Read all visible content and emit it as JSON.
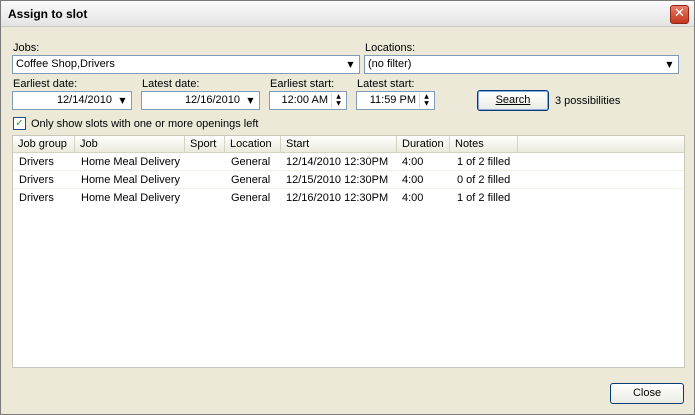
{
  "window": {
    "title": "Assign to slot"
  },
  "filters": {
    "jobs_label": "Jobs:",
    "jobs_value": "Coffee Shop,Drivers",
    "locations_label": "Locations:",
    "locations_value": "(no filter)",
    "earliest_date_label": "Earliest date:",
    "earliest_date_value": "12/14/2010",
    "latest_date_label": "Latest date:",
    "latest_date_value": "12/16/2010",
    "earliest_start_label": "Earliest start:",
    "earliest_start_value": "12:00 AM",
    "latest_start_label": "Latest start:",
    "latest_start_value": "11:59 PM",
    "search_label": "Search",
    "possibilities_text": "3 possibilities",
    "only_openings_label": "Only show slots with one or more openings left",
    "only_openings_checked": true
  },
  "table": {
    "columns": [
      "Job group",
      "Job",
      "Sport",
      "Location",
      "Start",
      "Duration",
      "Notes"
    ],
    "rows": [
      [
        "Drivers",
        "Home Meal Delivery",
        "",
        "General",
        "12/14/2010 12:30PM",
        "4:00",
        "1 of 2 filled"
      ],
      [
        "Drivers",
        "Home Meal Delivery",
        "",
        "General",
        "12/15/2010 12:30PM",
        "4:00",
        "0 of 2 filled"
      ],
      [
        "Drivers",
        "Home Meal Delivery",
        "",
        "General",
        "12/16/2010 12:30PM",
        "4:00",
        "1 of 2 filled"
      ]
    ]
  },
  "footer": {
    "close_label": "Close"
  },
  "icons": {
    "close": "close-icon",
    "dropdown": "chevron-down-icon",
    "spin_up": "arrow-up-icon",
    "spin_down": "arrow-down-icon",
    "check": "checkmark-icon"
  },
  "colors": {
    "window_bg": "#ece9d8",
    "input_border": "#7f9db9",
    "button_border": "#003c74",
    "close_red": "#c4361c"
  }
}
